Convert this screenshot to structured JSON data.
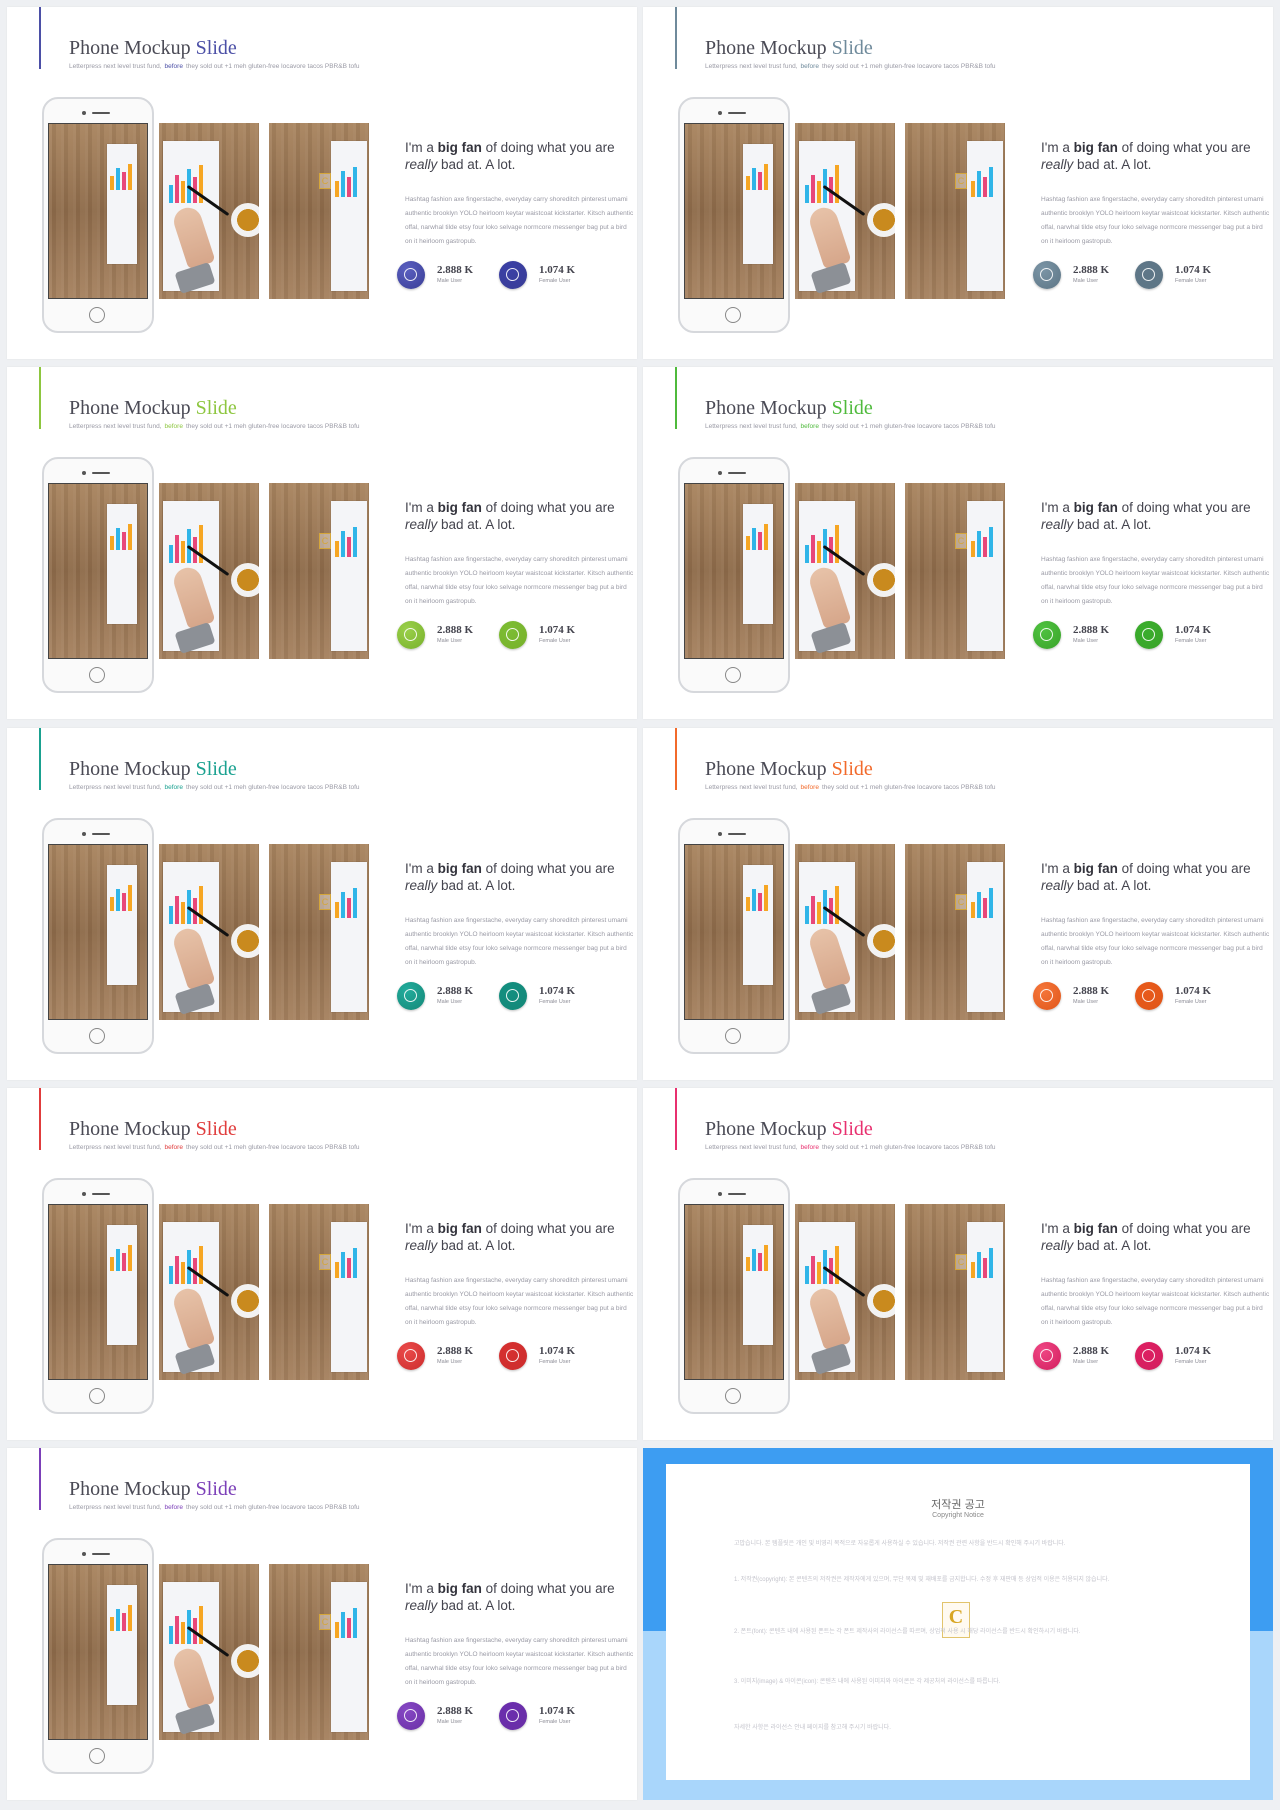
{
  "slide_title_main": "Phone Mockup",
  "slide_title_accent": "Slide",
  "subtitle_before": "Letterpress next level trust fund,",
  "subtitle_highlight": "before",
  "subtitle_after": "they sold out +1 meh gluten-free locavore tacos PBR&B tofu",
  "heading_pre": "I'm a ",
  "heading_bold": "big fan",
  "heading_mid": " of doing what you are ",
  "heading_em": "really",
  "heading_post": " bad at. A lot.",
  "body_text": "Hashtag fashion axe fingerstache, everyday carry shoreditch pinterest umami authentic brooklyn YOLO heirloom keytar waistcoat kickstarter. Kitsch authentic offal, narwhal tilde etsy four loko selvage normcore messenger bag put a bird on it heirloom gastropub.",
  "stat1_value": "2.888 K",
  "stat1_label": "Male User",
  "stat2_value": "1.074 K",
  "stat2_label": "Female User",
  "slides": [
    {
      "accent": "#4b4fa6",
      "dark": "#3a3e96",
      "stat1": "#5a5fc0",
      "stat2": "#3a3fa6"
    },
    {
      "accent": "#6f8a9b",
      "dark": "#5d7585",
      "stat1": "#7b95a6",
      "stat2": "#5f7788"
    },
    {
      "accent": "#8dc63f",
      "dark": "#78b12c",
      "stat1": "#9ad04a",
      "stat2": "#7cbd33"
    },
    {
      "accent": "#4fba3c",
      "dark": "#3aa32a",
      "stat1": "#4fc240",
      "stat2": "#3aae2c"
    },
    {
      "accent": "#1aa190",
      "dark": "#148878",
      "stat1": "#22ac9c",
      "stat2": "#138f80"
    },
    {
      "accent": "#f26a2b",
      "dark": "#e0561a",
      "stat1": "#f5763a",
      "stat2": "#e85a1b"
    },
    {
      "accent": "#e03c3c",
      "dark": "#cc2d2d",
      "stat1": "#ea4a4a",
      "stat2": "#d63030"
    },
    {
      "accent": "#e8306f",
      "dark": "#d21f5e",
      "stat1": "#ef4684",
      "stat2": "#de1f62"
    },
    {
      "accent": "#7b3fb8",
      "dark": "#6a2fa6",
      "stat1": "#8648c4",
      "stat2": "#6a2eae"
    }
  ],
  "copyright": {
    "title": "저작권 공고",
    "subtitle": "Copyright Notice",
    "logo_letter": "C",
    "paragraphs": [
      "고맙습니다. 본 템플릿은 개인 및 비영리 목적으로 자유롭게 사용하실 수 있습니다. 저작권 관련 사항을 반드시 확인해 주시기 바랍니다.",
      "1. 저작권(copyright): 본 콘텐츠의 저작권은 제작자에게 있으며, 무단 복제 및 재배포를 금지합니다. 수정 후 재판매 등 상업적 이용은 허용되지 않습니다.",
      "2. 폰트(font): 콘텐츠 내에 사용된 폰트는 각 폰트 제작사의 라이선스를 따르며, 상업적 사용 시 해당 라이선스를 반드시 확인하시기 바랍니다.",
      "3. 이미지(image) & 아이콘(icon): 콘텐츠 내에 사용된 이미지와 아이콘은 각 제공처의 라이선스를 따릅니다.",
      "자세한 사항은 라이선스 안내 페이지를 참고해 주시기 바랍니다."
    ]
  }
}
